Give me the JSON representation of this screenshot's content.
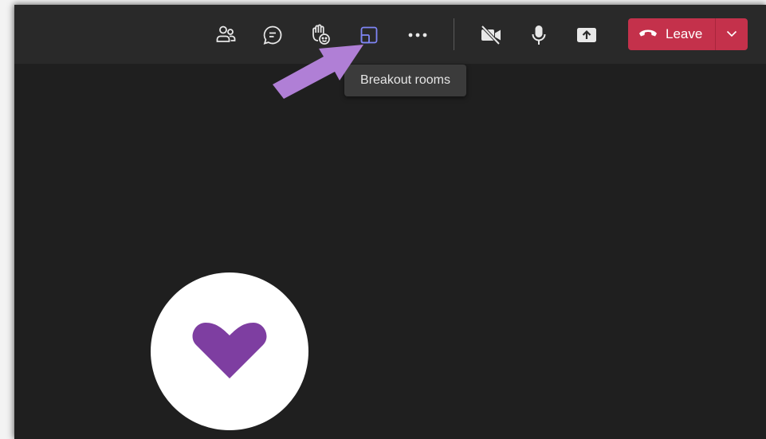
{
  "toolbar": {
    "buttons": [
      {
        "name": "participants-icon"
      },
      {
        "name": "chat-icon"
      },
      {
        "name": "reactions-icon"
      },
      {
        "name": "breakout-rooms-icon",
        "active": true,
        "color": "#7f85f5"
      },
      {
        "name": "more-options-icon"
      },
      {
        "name": "camera-off-icon"
      },
      {
        "name": "microphone-icon"
      },
      {
        "name": "share-screen-icon"
      }
    ],
    "leave": {
      "label": "Leave",
      "color": "#c4314b"
    }
  },
  "tooltip": {
    "text": "Breakout rooms"
  },
  "annotation": {
    "arrow_color": "#b07fd6"
  },
  "participant": {
    "avatar_heart_color": "#7e3ea1"
  }
}
